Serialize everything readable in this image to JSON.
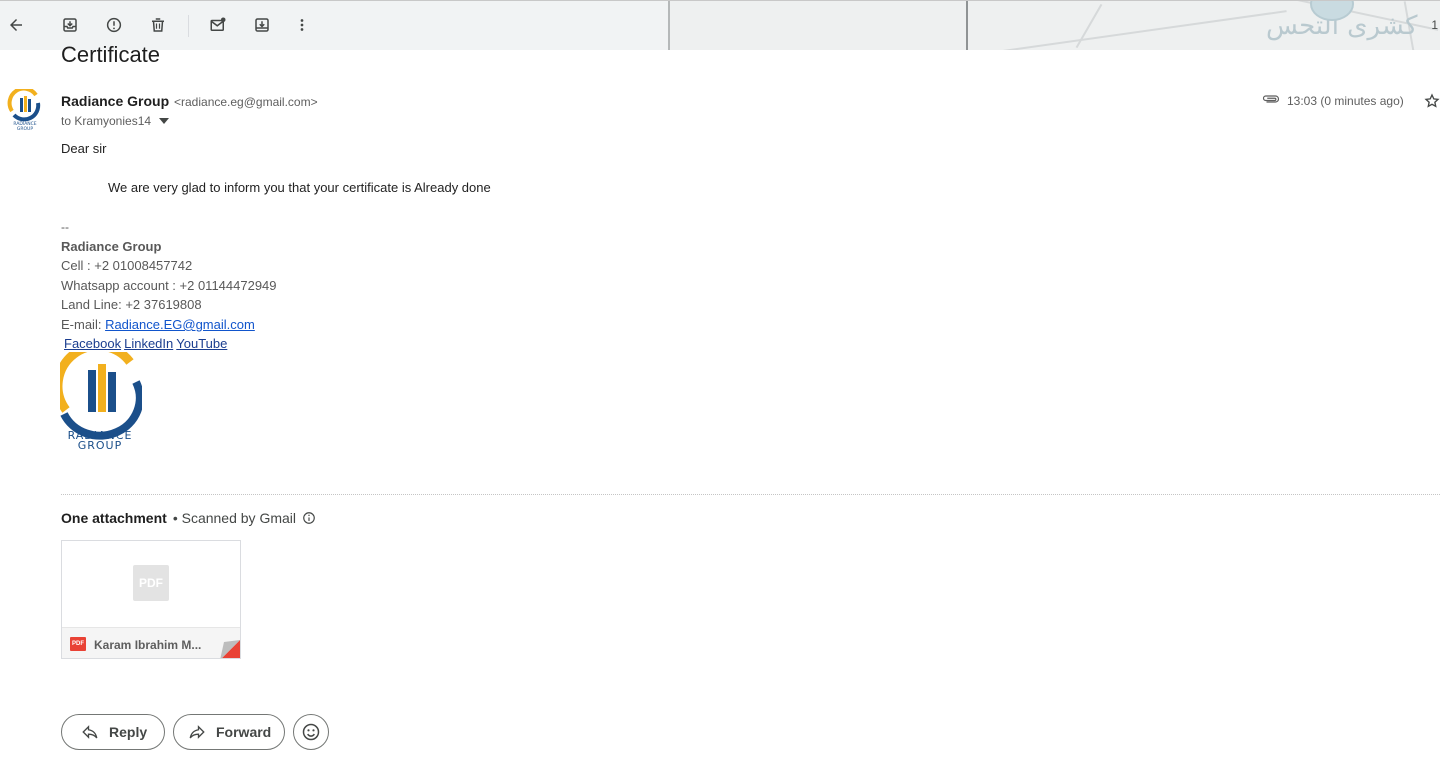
{
  "toolbar": {
    "icons": [
      "back-arrow-icon",
      "archive-icon",
      "report-spam-icon",
      "delete-icon",
      "mark-unread-icon",
      "move-to-icon",
      "more-vert-icon"
    ],
    "watermark": "كشرى التحس",
    "right_text": "1"
  },
  "email": {
    "subject": "Certificate",
    "sender_name": "Radiance Group",
    "sender_email": "<radiance.eg@gmail.com>",
    "to": "to Kramyonies14",
    "time": "13:03 (0 minutes ago)",
    "greeting": "Dear sir",
    "message": "We are very glad to inform you that your certificate is Already done"
  },
  "signature": {
    "separator": "--",
    "company": "Radiance Group",
    "cell": "Cell : +2 01008457742",
    "whatsapp": "Whatsapp account : +2 01144472949",
    "landline": "Land Line: +2 37619808",
    "email_label": "E-mail: ",
    "email_link": "Radiance.EG@gmail.com",
    "links": [
      "Facebook",
      "LinkedIn",
      "YouTube "
    ],
    "logo_line1": "RADIANCE",
    "logo_line2": "GROUP"
  },
  "attachments": {
    "title": "One attachment",
    "scanned": "• Scanned by Gmail",
    "file_type": "PDF",
    "file_name": "Karam Ibrahim M..."
  },
  "actions": {
    "reply": "Reply",
    "forward": "Forward"
  },
  "colors": {
    "accent_link": "#1155cc",
    "pdf_red": "#e94235",
    "logo_blue": "#1b4f8a",
    "logo_yellow": "#f2b01e"
  }
}
